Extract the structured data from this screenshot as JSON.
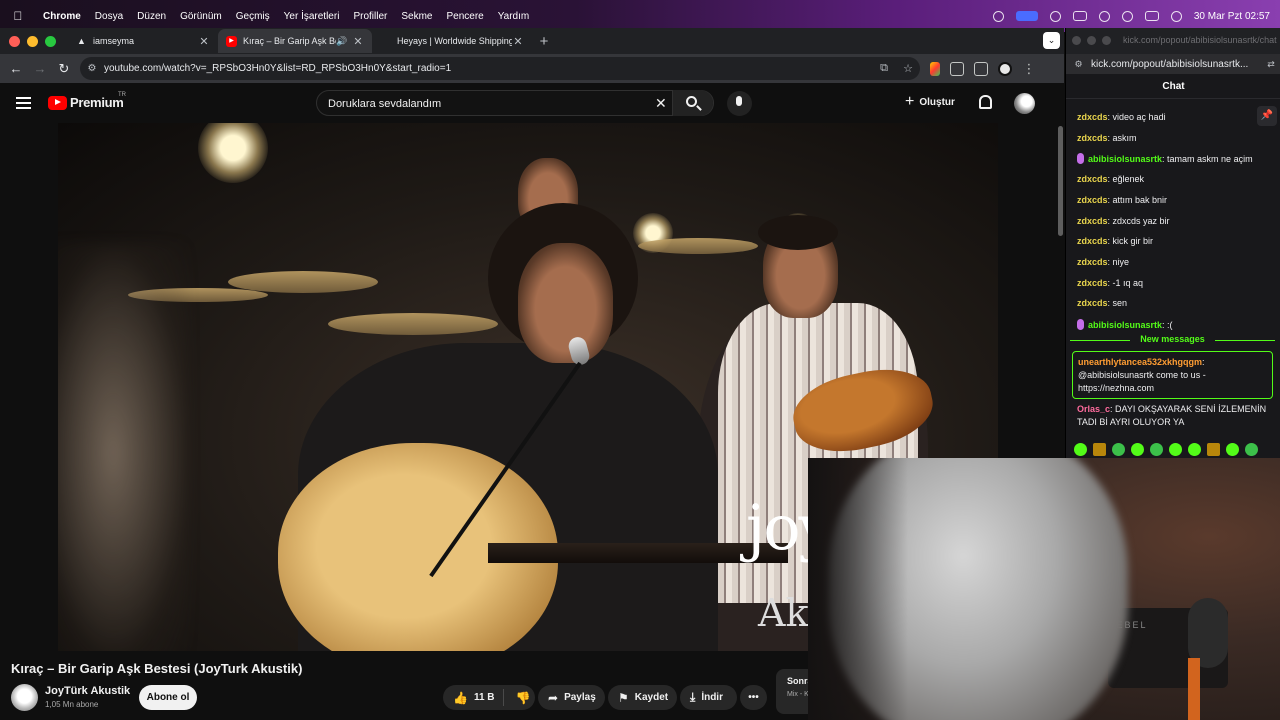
{
  "menubar": {
    "app": "Chrome",
    "items": [
      "Dosya",
      "Düzen",
      "Görünüm",
      "Geçmiş",
      "Yer İşaretleri",
      "Profiller",
      "Sekme",
      "Pencere",
      "Yardım"
    ],
    "datetime": "30 Mar Pzt  02:57"
  },
  "tabs": [
    {
      "label": "iamseyma"
    },
    {
      "label": "Kıraç – Bir Garip Aşk Bestesi"
    },
    {
      "label": "Heyays | Worldwide Shipping"
    }
  ],
  "address": {
    "url": "youtube.com/watch?v=_RPSbO3Hn0Y&list=RD_RPSbO3Hn0Y&start_radio=1"
  },
  "youtube": {
    "logo_word": "Premium",
    "region": "TR",
    "search_query": "Doruklara sevdalandım",
    "create_label": "Oluştur"
  },
  "video": {
    "title": "Kıraç – Bir Garip Aşk Bestesi (JoyTurk Akustik)",
    "watermark_1": "joy",
    "watermark_2": "Ak",
    "channel_name": "JoyTürk Akustik",
    "subscribers": "1,05 Mn abone",
    "subscribe_label": "Abone ol",
    "likes": "11 B",
    "share_label": "Paylaş",
    "save_label": "Kaydet",
    "download_label": "İndir",
    "next_title": "Sonra",
    "next_sub": "Mix - K"
  },
  "kick": {
    "window_title": "kick.com/popout/abibisiolsunasrtk/chat",
    "url": "kick.com/popout/abibisiolsunasrtk...",
    "header": "Chat",
    "messages": [
      {
        "user": "zdxcds",
        "text": "video aç hadi",
        "color": "#e8d44d",
        "badge": false
      },
      {
        "user": "zdxcds",
        "text": "askım",
        "color": "#e8d44d",
        "badge": false
      },
      {
        "user": "abibisiolsunasrtk",
        "text": "tamam askm ne açim",
        "color": "#53fc18",
        "badge": true
      },
      {
        "user": "zdxcds",
        "text": "eğlenek",
        "color": "#e8d44d",
        "badge": false
      },
      {
        "user": "zdxcds",
        "text": "attım bak bnir",
        "color": "#e8d44d",
        "badge": false
      },
      {
        "user": "zdxcds",
        "text": "zdxcds yaz bir",
        "color": "#e8d44d",
        "badge": false
      },
      {
        "user": "zdxcds",
        "text": "kick gir bir",
        "color": "#e8d44d",
        "badge": false
      },
      {
        "user": "zdxcds",
        "text": "niye",
        "color": "#e8d44d",
        "badge": false
      },
      {
        "user": "zdxcds",
        "text": "-1 ıq aq",
        "color": "#e8d44d",
        "badge": false
      },
      {
        "user": "zdxcds",
        "text": "sen",
        "color": "#e8d44d",
        "badge": false
      },
      {
        "user": "abibisiolsunasrtk",
        "text": ":(",
        "color": "#53fc18",
        "badge": true
      }
    ],
    "new_messages": "New messages",
    "highlight": {
      "user": "unearthlytancea532xkhgqgm",
      "text": "@abibisiolsunasrtk come to us - https://nezhna.com"
    },
    "last": {
      "user": "Orlas_c",
      "text": "DAYI OKŞAYARAK SENİ İZLEMENİN TADI Bİ AYRI OLUYOR YA"
    }
  },
  "webcam": {
    "gear_label": "REBEL"
  },
  "colors": {
    "accent_kick": "#53fc18",
    "youtube_red": "#ff0000",
    "bg": "#0f0f0f"
  }
}
